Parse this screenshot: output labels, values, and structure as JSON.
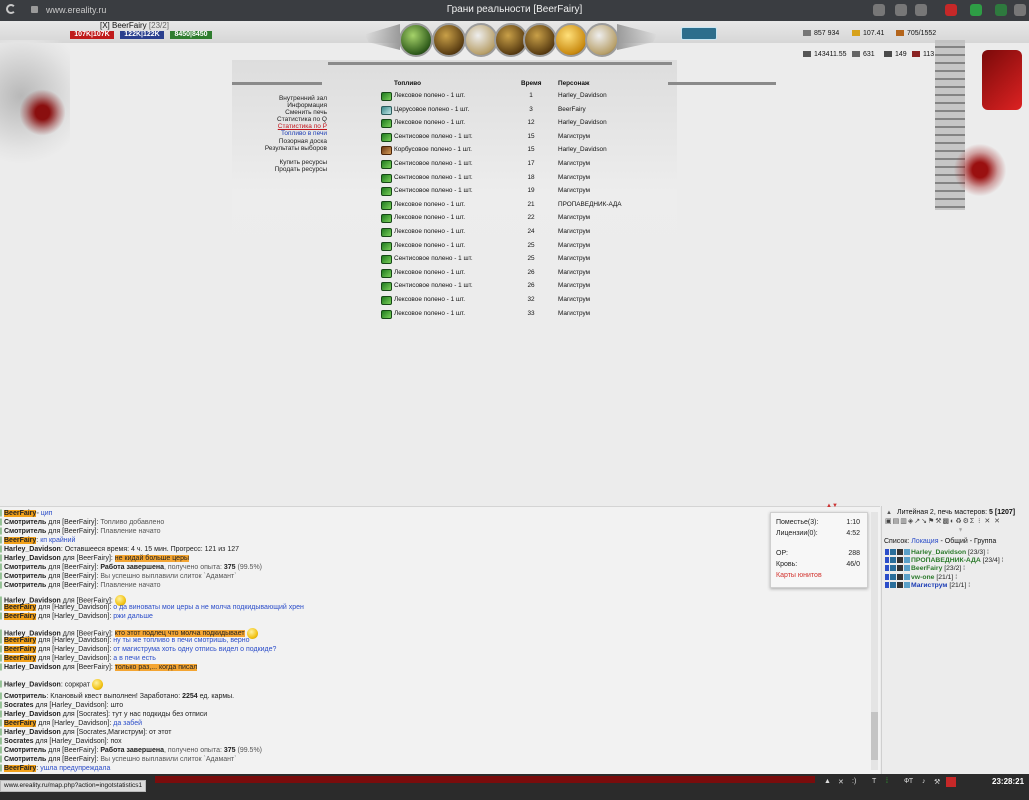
{
  "browser": {
    "url": "www.ereality.ru",
    "title": "Грани реальности [BeerFairy]"
  },
  "character": {
    "name": "[X] BeerFairy",
    "level": "[23/2]",
    "hp": "107K|107K",
    "mp": "122K|122K",
    "energy": "8450|8450"
  },
  "resources": {
    "r1": "857 934",
    "r2": "107.41",
    "r3": "705/1552",
    "r4": "143411.55",
    "r5": "631",
    "r6": "149",
    "r7": "113"
  },
  "left_menu": {
    "items": [
      "Внутренний зал",
      "Информация",
      "Сменить печь",
      "Статистика по Q",
      "Статистика по Р",
      "Топливо в печи",
      "Позорная доска",
      "Результаты выборов"
    ],
    "items2": [
      "Купить ресурсы",
      "Продать ресурсы"
    ],
    "active": "Статистика по Р",
    "link": "Топливо в печи"
  },
  "fuel_table": {
    "headers": [
      "Топливо",
      "Время",
      "Персонаж"
    ],
    "rows": [
      {
        "fuel": "Лексовое полено - 1 шт.",
        "time": "1",
        "char": "Harley_Davidson",
        "icon": "green"
      },
      {
        "fuel": "Церусовое полено - 1 шт.",
        "time": "3",
        "char": "BeerFairy",
        "icon": "teal"
      },
      {
        "fuel": "Лексовое полено - 1 шт.",
        "time": "12",
        "char": "Harley_Davidson",
        "icon": "green"
      },
      {
        "fuel": "Сентисовое полено - 1 шт.",
        "time": "15",
        "char": "Магиструм",
        "icon": "green"
      },
      {
        "fuel": "Корбусовое полено - 1 шт.",
        "time": "15",
        "char": "Harley_Davidson",
        "icon": "brown"
      },
      {
        "fuel": "Сентисовое полено - 1 шт.",
        "time": "17",
        "char": "Магиструм",
        "icon": "green"
      },
      {
        "fuel": "Сентисовое полено - 1 шт.",
        "time": "18",
        "char": "Магиструм",
        "icon": "green"
      },
      {
        "fuel": "Сентисовое полено - 1 шт.",
        "time": "19",
        "char": "Магиструм",
        "icon": "green"
      },
      {
        "fuel": "Лексовое полено - 1 шт.",
        "time": "21",
        "char": "ПРОПАВЕДНИК-АДА",
        "icon": "green"
      },
      {
        "fuel": "Лексовое полено - 1 шт.",
        "time": "22",
        "char": "Магиструм",
        "icon": "green"
      },
      {
        "fuel": "Лексовое полено - 1 шт.",
        "time": "24",
        "char": "Магиструм",
        "icon": "green"
      },
      {
        "fuel": "Лексовое полено - 1 шт.",
        "time": "25",
        "char": "Магиструм",
        "icon": "green"
      },
      {
        "fuel": "Сентисовое полено - 1 шт.",
        "time": "25",
        "char": "Магиструм",
        "icon": "green"
      },
      {
        "fuel": "Лексовое полено - 1 шт.",
        "time": "26",
        "char": "Магиструм",
        "icon": "green"
      },
      {
        "fuel": "Сентисовое полено - 1 шт.",
        "time": "26",
        "char": "Магиструм",
        "icon": "green"
      },
      {
        "fuel": "Лексовое полено - 1 шт.",
        "time": "32",
        "char": "Магиструм",
        "icon": "green"
      },
      {
        "fuel": "Лексовое полено - 1 шт.",
        "time": "33",
        "char": "Магиструм",
        "icon": "green"
      }
    ]
  },
  "chat": {
    "lines": [
      {
        "parts": [
          [
            "hl b",
            "BeerFairy"
          ],
          [
            "",
            "◦ "
          ],
          [
            "bl",
            "цип"
          ]
        ]
      },
      {
        "parts": [
          [
            "b",
            "Смотритель"
          ],
          [
            "",
            " для [BeerFairy]: "
          ],
          [
            "gr",
            "Топливо добавлено"
          ]
        ]
      },
      {
        "parts": [
          [
            "b",
            "Смотритель"
          ],
          [
            "",
            " для [BeerFairy]: "
          ],
          [
            "gr",
            "Плавление начато"
          ]
        ]
      },
      {
        "parts": [
          [
            "hl b",
            "BeerFairy"
          ],
          [
            "",
            ": "
          ],
          [
            "bl",
            "кп крайний"
          ]
        ]
      },
      {
        "parts": [
          [
            "b",
            "Harley_Davidson"
          ],
          [
            "",
            ": Оставшееся время: 4 ч. 15 мин. Прогресс: 121 из 127"
          ]
        ]
      },
      {
        "parts": [
          [
            "b",
            "Harley_Davidson"
          ],
          [
            "",
            " для [BeerFairy]: "
          ],
          [
            "hlmsg",
            "не кидай больше церы"
          ]
        ]
      },
      {
        "parts": [
          [
            "b",
            "Смотритель"
          ],
          [
            "",
            " для [BeerFairy]: "
          ],
          [
            "b",
            "Работа завершена"
          ],
          [
            "gr",
            ", получено опыта: "
          ],
          [
            "b",
            "375"
          ],
          [
            "gr",
            " (99.5%)"
          ]
        ]
      },
      {
        "parts": [
          [
            "b",
            "Смотритель"
          ],
          [
            "",
            " для [BeerFairy]: "
          ],
          [
            "gr",
            "Вы успешно выплавили слиток `Адамант`"
          ]
        ]
      },
      {
        "parts": [
          [
            "b",
            "Смотритель"
          ],
          [
            "",
            " для [BeerFairy]: "
          ],
          [
            "gr",
            "Плавление начато"
          ]
        ]
      },
      {
        "parts": [
          [
            "b",
            "Harley_Davidson"
          ],
          [
            "",
            " для [BeerFairy]: "
          ]
        ]
      },
      {
        "parts": [
          [
            "hl b",
            "BeerFairy"
          ],
          [
            "",
            " для [Harley_Davidson]: "
          ],
          [
            "bl",
            "о да виноваты мои церы а не молча подкидывающий хрен"
          ]
        ]
      },
      {
        "parts": [
          [
            "hl b",
            "BeerFairy"
          ],
          [
            "",
            " для [Harley_Davidson]: "
          ],
          [
            "bl",
            "ржи дальше"
          ]
        ]
      },
      {
        "parts": [
          [
            "b",
            "Harley_Davidson"
          ],
          [
            "",
            " для [BeerFairy]: "
          ],
          [
            "hlmsg",
            "кто этот подлец что молча подкидывает"
          ]
        ]
      },
      {
        "parts": [
          [
            "hl b",
            "BeerFairy"
          ],
          [
            "",
            " для [Harley_Davidson]: "
          ],
          [
            "bl",
            "ну ты же топливо в печи смотришь, верно"
          ]
        ]
      },
      {
        "parts": [
          [
            "hl b",
            "BeerFairy"
          ],
          [
            "",
            " для [Harley_Davidson]: "
          ],
          [
            "bl",
            "от магиструма хоть одну отпись видел о подкиде?"
          ]
        ]
      },
      {
        "parts": [
          [
            "hl b",
            "BeerFairy"
          ],
          [
            "",
            " для [Harley_Davidson]: "
          ],
          [
            "bl",
            "а в печи есть"
          ]
        ]
      },
      {
        "parts": [
          [
            "b",
            "Harley_Davidson"
          ],
          [
            "",
            " для [BeerFairy]: "
          ],
          [
            "hlmsg",
            "только раз,... когда писал"
          ]
        ]
      },
      {
        "parts": [
          [
            "b",
            "Harley_Davidson"
          ],
          [
            "",
            ": соркрат"
          ]
        ]
      },
      {
        "parts": [
          [
            "b",
            "Смотритель"
          ],
          [
            "",
            ":      Клановый квест выполнен! Заработано: "
          ],
          [
            "b",
            "2254"
          ],
          [
            "",
            " ед. кармы."
          ]
        ]
      },
      {
        "parts": [
          [
            "b",
            "Socrates"
          ],
          [
            "",
            " для [Harley_Davidson]: што"
          ]
        ]
      },
      {
        "parts": [
          [
            "b",
            "Harley_Davidson"
          ],
          [
            "",
            " для [Socrates]: тут у нас подкиды без отписи"
          ]
        ]
      },
      {
        "parts": [
          [
            "hl b",
            "BeerFairy"
          ],
          [
            "",
            " для [Harley_Davidson]: "
          ],
          [
            "bl",
            "да забей"
          ]
        ]
      },
      {
        "parts": [
          [
            "b",
            "Harley_Davidson"
          ],
          [
            "",
            " для [Socrates,Магиструм]: от этот"
          ]
        ]
      },
      {
        "parts": [
          [
            "b",
            "Socrates"
          ],
          [
            "",
            " для [Harley_Davidson]: пох"
          ]
        ]
      },
      {
        "parts": [
          [
            "b",
            "Смотритель"
          ],
          [
            "",
            " для [BeerFairy]: "
          ],
          [
            "b",
            "Работа завершена"
          ],
          [
            "gr",
            ", получено опыта: "
          ],
          [
            "b",
            "375"
          ],
          [
            "gr",
            " (99.5%)"
          ]
        ]
      },
      {
        "parts": [
          [
            "b",
            "Смотритель"
          ],
          [
            "",
            " для [BeerFairy]: "
          ],
          [
            "gr",
            "Вы успешно выплавили слиток `Адамант`"
          ]
        ]
      },
      {
        "parts": [
          [
            "hl b",
            "BeerFairy"
          ],
          [
            "",
            ": "
          ],
          [
            "bl",
            "ушла предупреждала"
          ]
        ]
      }
    ]
  },
  "popup": {
    "row1_label": "Поместье(3):",
    "row1_val": "1:10",
    "row2_label": "Лицензии(0):",
    "row2_val": "4:52",
    "row3_label": "ОР:",
    "row3_val": "288",
    "row4_label": "Кровь:",
    "row4_val": "46/0",
    "link": "Карты юнитов"
  },
  "right_panel": {
    "location": "Литейная 2, печь мастеров:",
    "count": "5",
    "total": "[1207]",
    "list_label": "Список:",
    "tab_location": "Локация",
    "tab_common": "Общий",
    "tab_group": "Группа",
    "players": [
      {
        "name": "Harley_Davidson",
        "level": "[23/3]",
        "color": "green"
      },
      {
        "name": "ПРОПАВЕДНИК-АДА",
        "level": "[23/4]",
        "color": "green"
      },
      {
        "name": "BeerFairy",
        "level": "[23/2]",
        "color": "green"
      },
      {
        "name": "vw-one",
        "level": "[21/1]",
        "color": "green"
      },
      {
        "name": "Магиструм",
        "level": "[21/1]",
        "color": "blue"
      }
    ]
  },
  "statusbar": {
    "url": "www.ereality.ru/map.php?action=ingotstatistics1"
  },
  "clock": "23:28:21"
}
